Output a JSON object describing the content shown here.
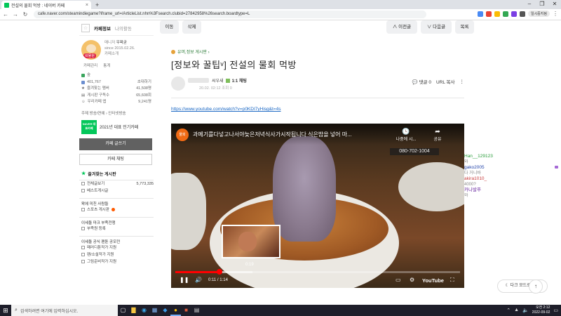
{
  "browser": {
    "tab_title": "전설의 물회 먹방 : 네이버 카페",
    "tab_close": "×",
    "new_tab": "+",
    "url": "cafe.naver.com/steamindiegame?iframe_url=/ArticleList.nhn%3Fsearch.clubid=27842958%26search.boardtype=L",
    "profile_label": "일시중지됨",
    "window_controls": [
      "–",
      "❐",
      "✕"
    ]
  },
  "sidebar": {
    "tabs": [
      "카페정보",
      "나의활동"
    ],
    "logo_text": "왁물원",
    "manager_label": "매니저",
    "manager_name": "우왁굳",
    "since": "since 2015.02.26.",
    "cafe_intro": "카페소개",
    "manage_links": [
      "카페관리",
      "통계"
    ],
    "level_icon": "숲",
    "stats": [
      {
        "label": "401,767",
        "value": "초대하기"
      },
      {
        "label": "즐겨찾는 멤버",
        "value": "41,508명"
      },
      {
        "label": "게시판 구독수",
        "value": "65,608회"
      },
      {
        "label": "우리카페 앱",
        "value": "9,241명"
      }
    ],
    "topic": "주제 방송/연예 › 인터넷방송",
    "naver_badge": "NAVER 대표카페",
    "badge_text": "2021년 대표 인기카페",
    "write_button": "카페 글쓰기",
    "chat_button": "카페 채팅",
    "fav_boards_title": "즐겨찾는 게시판",
    "menu_items": [
      {
        "label": "전체글보기",
        "count": "5,773,335"
      },
      {
        "label": "베스트게시글",
        "count": ""
      }
    ],
    "groups": [
      {
        "title": "왁에 미친 사람들",
        "items": [
          "스포츠 게시판"
        ]
      },
      {
        "title": "이세돌 마크 부족전쟁",
        "items": [
          "부족원 등록"
        ]
      },
      {
        "title": "이세돌 공식 팬툰 공모전",
        "items": [
          "패러디툰작가 지원",
          "팬/소설작가 지원",
          "그림준비작가 지원"
        ]
      }
    ]
  },
  "toolbar": {
    "move": "이동",
    "delete": "삭제",
    "prev": "∧ 이전글",
    "next": "∨ 다음글",
    "list": "목록"
  },
  "article": {
    "board": "유머,정보 게시판 ›",
    "title": "[정보와 꿀팁ᵛ] 전설의 물회 먹방",
    "writer_rank": "씨우새",
    "chat_badge": "1:1 채팅",
    "meta": "20.02. 02:12   조회 0",
    "comments": "댓글 0",
    "url_copy": "URL 복사",
    "link": "https://www.youtube.com/watch?v=p0KDI7yHisg&t=4s"
  },
  "video": {
    "channel_badge": "물회",
    "title": "과메기를다넣고나서야늦은저녁식사가시작됩니다 식은밥을 넣어 마...",
    "watch_later": "나중에 시...",
    "share": "공유",
    "banner": "080-702-1004",
    "hover_time": "0:19",
    "current_time": "0:11 / 1:14",
    "brand": "YouTube",
    "played_fraction": 0.155,
    "hover_fraction": 0.27
  },
  "chat": [
    {
      "name": "Han__129123",
      "message": "와",
      "color": "#2a9d3a"
    },
    {
      "name": "gako2005",
      "message": "다 거니바",
      "color": "#2244aa"
    },
    {
      "name": "akira1010_",
      "message": "4000?",
      "color": "#c93a3a"
    },
    {
      "name": "카나발푸",
      "message": "와",
      "color": "#6a2aa0"
    }
  ],
  "buttons": {
    "dark_mode": "다크 모드로 보기",
    "scroll_top": "↑"
  },
  "taskbar": {
    "start": "⊞",
    "search_placeholder": "검색하려면 여기에 입력하십시오.",
    "time": "오전 2:12",
    "date": "2022-09-02"
  },
  "colors": {
    "naver_green": "#03c75a",
    "youtube_red": "#ff0000",
    "link_blue": "#1a67c4"
  }
}
